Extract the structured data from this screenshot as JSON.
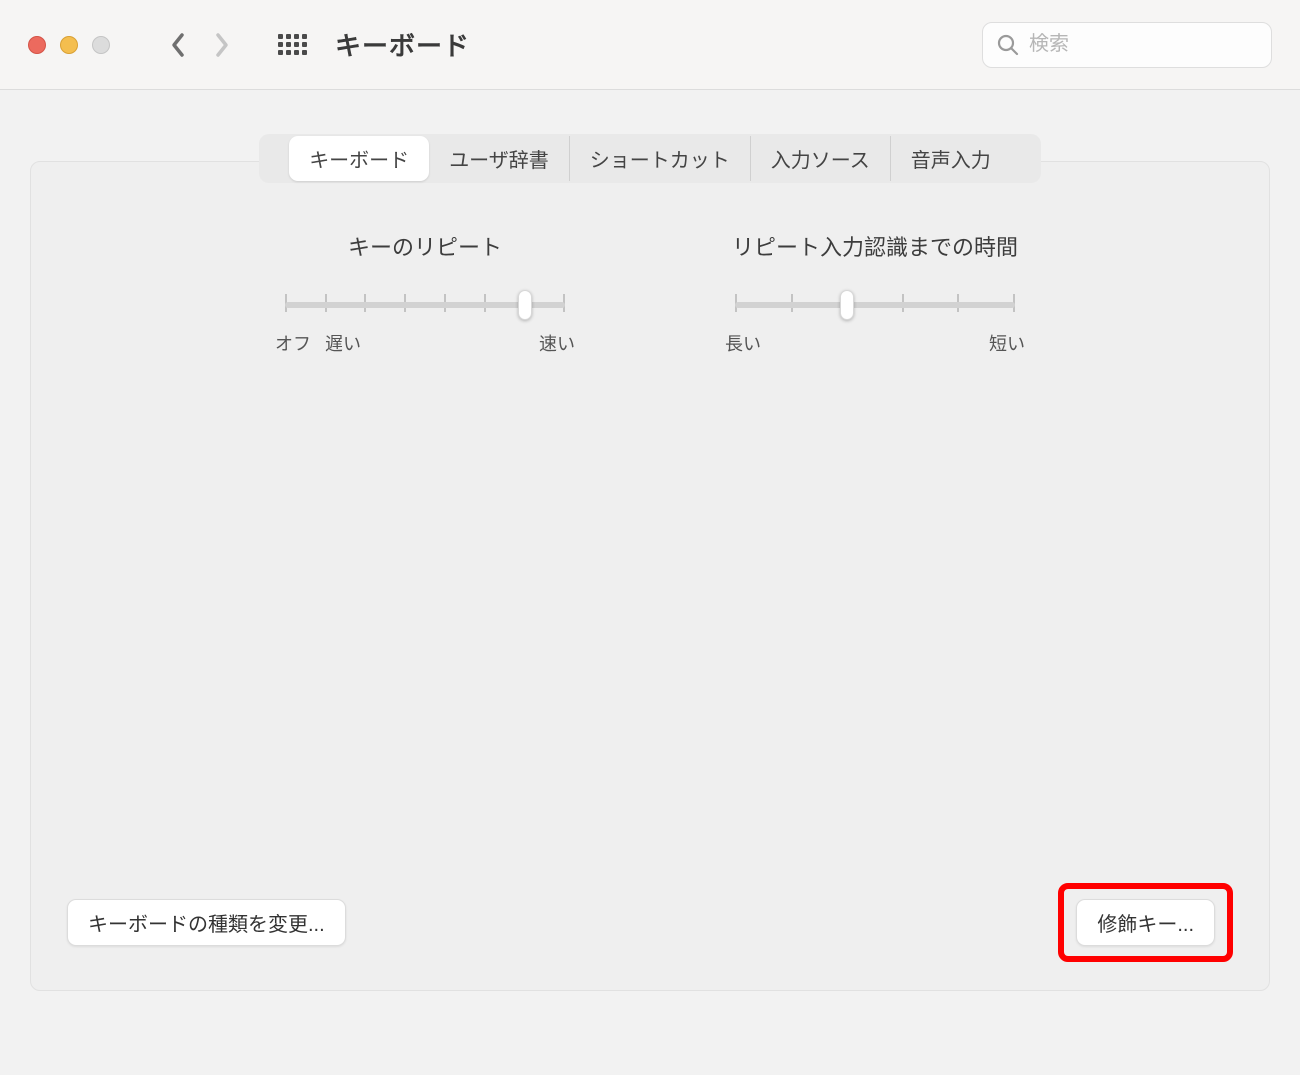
{
  "window": {
    "title": "キーボード"
  },
  "search": {
    "placeholder": "検索"
  },
  "tabs": [
    {
      "label": "キーボード",
      "selected": true
    },
    {
      "label": "ユーザ辞書",
      "selected": false
    },
    {
      "label": "ショートカット",
      "selected": false
    },
    {
      "label": "入力ソース",
      "selected": false
    },
    {
      "label": "音声入力",
      "selected": false
    }
  ],
  "sliders": {
    "keyRepeat": {
      "title": "キーのリピート",
      "ticks": 8,
      "value": 6,
      "leftLabel1": "オフ",
      "leftLabel2": "遅い",
      "rightLabel": "速い"
    },
    "delay": {
      "title": "リピート入力認識までの時間",
      "ticks": 6,
      "value": 2,
      "leftLabel": "長い",
      "rightLabel": "短い"
    }
  },
  "buttons": {
    "changeKeyboardType": "キーボードの種類を変更...",
    "modifierKeys": "修飾キー..."
  }
}
